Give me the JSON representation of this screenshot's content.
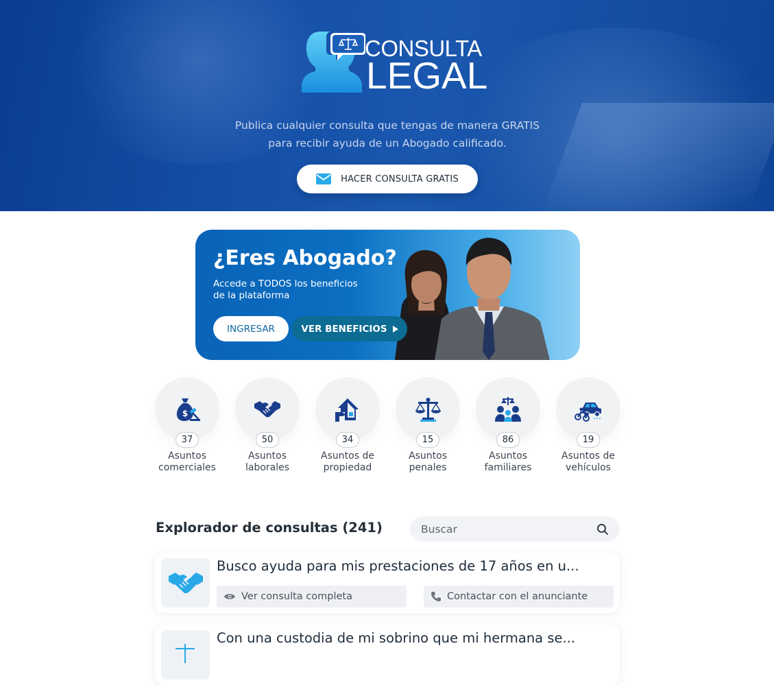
{
  "hero": {
    "logo_line1": "CONSULTA",
    "logo_line2": "LEGAL",
    "subtitle_line1": "Publica cualquier consulta que tengas de manera GRATIS",
    "subtitle_line2": "para recibir ayuda de un Abogado calificado.",
    "cta_label": "HACER CONSULTA GRATIS",
    "cta_icon": "envelope-icon"
  },
  "banner": {
    "title": "¿Eres Abogado?",
    "subtitle_line1": "Accede a TODOS los beneficios",
    "subtitle_line2": "de la plataforma",
    "login_label": "INGRESAR",
    "benefits_label": "VER BENEFICIOS"
  },
  "categories": [
    {
      "count": "37",
      "label_line1": "Asuntos",
      "label_line2": "comerciales",
      "icon": "money-bag-gavel-icon"
    },
    {
      "count": "50",
      "label_line1": "Asuntos",
      "label_line2": "laborales",
      "icon": "handshake-icon"
    },
    {
      "count": "34",
      "label_line1": "Asuntos de",
      "label_line2": "propiedad",
      "icon": "house-hand-icon"
    },
    {
      "count": "15",
      "label_line1": "Asuntos",
      "label_line2": "penales",
      "icon": "scales-icon"
    },
    {
      "count": "86",
      "label_line1": "Asuntos",
      "label_line2": "familiares",
      "icon": "family-scales-icon"
    },
    {
      "count": "19",
      "label_line1": "Asuntos de",
      "label_line2": "vehículos",
      "icon": "vehicles-icon"
    }
  ],
  "explorer": {
    "title": "Explorador de consultas (241)",
    "search_placeholder": "Buscar",
    "items": [
      {
        "title": "Busco ayuda para mis prestaciones de 17 años en u...",
        "view_label": "Ver consulta completa",
        "contact_label": "Contactar con el anunciante",
        "icon": "handshake-icon"
      },
      {
        "title": "Con una custodia de mi sobrino que mi hermana se...",
        "icon": "scales-icon"
      }
    ]
  },
  "colors": {
    "hero_bg": "#1550a8",
    "accent_blue": "#0b6fc2",
    "icon_navy": "#1a3e8c",
    "icon_light": "#29a9e8"
  }
}
